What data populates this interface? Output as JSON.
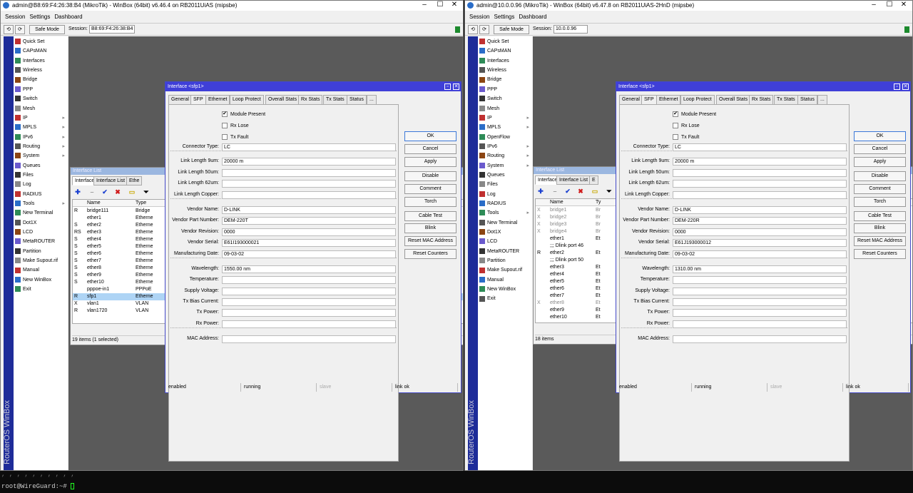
{
  "terminal": {
    "line1": "  , , , ,  , , ,   , ,  ,",
    "prompt": "root@WireGuard:~#"
  },
  "windows": [
    {
      "title": "admin@B8:69:F4:26:38:B4 (MikroTik) - WinBox (64bit) v6.46.4 on RB2011UiAS (mipsbe)",
      "menu": [
        "Session",
        "Settings",
        "Dashboard"
      ],
      "safe_mode": "Safe Mode",
      "session_label": "Session:",
      "session_value": "B8:69:F4:26:38:B4",
      "sidebar_text": "RouterOS WinBox",
      "nav": [
        {
          "label": "Quick Set",
          "icon": "quick-set-icon",
          "arrow": false
        },
        {
          "label": "CAPsMAN",
          "icon": "capsman-icon",
          "arrow": false
        },
        {
          "label": "Interfaces",
          "icon": "interfaces-icon",
          "arrow": false
        },
        {
          "label": "Wireless",
          "icon": "wireless-icon",
          "arrow": false
        },
        {
          "label": "Bridge",
          "icon": "bridge-icon",
          "arrow": false
        },
        {
          "label": "PPP",
          "icon": "ppp-icon",
          "arrow": false
        },
        {
          "label": "Switch",
          "icon": "switch-icon",
          "arrow": false
        },
        {
          "label": "Mesh",
          "icon": "mesh-icon",
          "arrow": false
        },
        {
          "label": "IP",
          "icon": "ip-icon",
          "arrow": true
        },
        {
          "label": "MPLS",
          "icon": "mpls-icon",
          "arrow": true
        },
        {
          "label": "IPv6",
          "icon": "ipv6-icon",
          "arrow": true
        },
        {
          "label": "Routing",
          "icon": "routing-icon",
          "arrow": true
        },
        {
          "label": "System",
          "icon": "system-icon",
          "arrow": true
        },
        {
          "label": "Queues",
          "icon": "queues-icon",
          "arrow": false
        },
        {
          "label": "Files",
          "icon": "files-icon",
          "arrow": false
        },
        {
          "label": "Log",
          "icon": "log-icon",
          "arrow": false
        },
        {
          "label": "RADIUS",
          "icon": "radius-icon",
          "arrow": false
        },
        {
          "label": "Tools",
          "icon": "tools-icon",
          "arrow": true
        },
        {
          "label": "New Terminal",
          "icon": "terminal-icon",
          "arrow": false
        },
        {
          "label": "Dot1X",
          "icon": "dot1x-icon",
          "arrow": false
        },
        {
          "label": "LCD",
          "icon": "lcd-icon",
          "arrow": false
        },
        {
          "label": "MetaROUTER",
          "icon": "metarouter-icon",
          "arrow": false
        },
        {
          "label": "Partition",
          "icon": "partition-icon",
          "arrow": false
        },
        {
          "label": "Make Supout.rif",
          "icon": "supout-icon",
          "arrow": false
        },
        {
          "label": "Manual",
          "icon": "manual-icon",
          "arrow": false
        },
        {
          "label": "New WinBox",
          "icon": "winbox-icon",
          "arrow": false
        },
        {
          "label": "Exit",
          "icon": "exit-icon",
          "arrow": false
        }
      ],
      "list": {
        "title": "Interface List",
        "tabs": [
          "Interface",
          "Interface List",
          "Ethe"
        ],
        "col_name": "Name",
        "col_type": "Type",
        "rows": [
          {
            "flag": "R",
            "name": "bridge111",
            "type": "Bridge"
          },
          {
            "flag": "",
            "name": "ether1",
            "type": "Etherne"
          },
          {
            "flag": "S",
            "name": "ether2",
            "type": "Etherne"
          },
          {
            "flag": "RS",
            "name": "ether3",
            "type": "Etherne"
          },
          {
            "flag": "S",
            "name": "ether4",
            "type": "Etherne"
          },
          {
            "flag": "S",
            "name": "ether5",
            "type": "Etherne"
          },
          {
            "flag": "S",
            "name": "ether6",
            "type": "Etherne"
          },
          {
            "flag": "S",
            "name": "ether7",
            "type": "Etherne"
          },
          {
            "flag": "S",
            "name": "ether8",
            "type": "Etherne"
          },
          {
            "flag": "S",
            "name": "ether9",
            "type": "Etherne"
          },
          {
            "flag": "S",
            "name": "ether10",
            "type": "Etherne"
          },
          {
            "flag": "",
            "name": "pppoe-in1",
            "type": "PPPoE"
          },
          {
            "flag": "R",
            "name": "sfp1",
            "type": "Etherne"
          },
          {
            "flag": "X",
            "name": "vlan1",
            "type": "VLAN"
          },
          {
            "flag": "R",
            "name": "vlan1720",
            "type": "VLAN"
          }
        ],
        "footer": "19 items (1 selected)"
      },
      "dialog": {
        "title": "Interface <sfp1>",
        "tabs": [
          "General",
          "SFP",
          "Ethernet",
          "Loop Protect",
          "Overall Stats",
          "Rx Stats",
          "Tx Stats",
          "Status",
          "..."
        ],
        "checks": [
          {
            "label": "Module Present",
            "checked": true
          },
          {
            "label": "Rx Lose",
            "checked": false
          },
          {
            "label": "Tx Fault",
            "checked": false
          }
        ],
        "fields": [
          {
            "label": "Connector Type:",
            "value": "LC"
          },
          {
            "label": "Link Length 9um:",
            "value": "20000 m"
          },
          {
            "label": "Link Length 50um:",
            "value": ""
          },
          {
            "label": "Link Length 62um:",
            "value": ""
          },
          {
            "label": "Link Length Copper:",
            "value": ""
          },
          {
            "label": "Vendor Name:",
            "value": "D-LINK"
          },
          {
            "label": "Vendor Part Number:",
            "value": "DEM-220T"
          },
          {
            "label": "Vendor Revision:",
            "value": "0000"
          },
          {
            "label": "Vendor Serial:",
            "value": "E61I193000021"
          },
          {
            "label": "Manufacturing Date:",
            "value": "09-03-02"
          },
          {
            "label": "Wavelength:",
            "value": "1550.00 nm"
          },
          {
            "label": "Temperature:",
            "value": ""
          },
          {
            "label": "Supply Voltage:",
            "value": ""
          },
          {
            "label": "Tx Bias Current:",
            "value": ""
          },
          {
            "label": "Tx Power:",
            "value": ""
          },
          {
            "label": "Rx Power:",
            "value": ""
          },
          {
            "label": "MAC Address:",
            "value": ""
          }
        ],
        "buttons": [
          "OK",
          "Cancel",
          "Apply",
          "Disable",
          "Comment",
          "Torch",
          "Cable Test",
          "Blink",
          "Reset MAC Address",
          "Reset Counters"
        ],
        "status": [
          "enabled",
          "running",
          "slave",
          "link ok"
        ]
      }
    },
    {
      "title": "admin@10.0.0.96 (MikroTik) - WinBox (64bit) v6.47.8 on RB2011UiAS-2HnD (mipsbe)",
      "menu": [
        "Session",
        "Settings",
        "Dashboard"
      ],
      "safe_mode": "Safe Mode",
      "session_label": "Session:",
      "session_value": "10.0.0.96",
      "sidebar_text": "RouterOS WinBox",
      "nav": [
        {
          "label": "Quick Set",
          "icon": "quick-set-icon",
          "arrow": false
        },
        {
          "label": "CAPsMAN",
          "icon": "capsman-icon",
          "arrow": false
        },
        {
          "label": "Interfaces",
          "icon": "interfaces-icon",
          "arrow": false
        },
        {
          "label": "Wireless",
          "icon": "wireless-icon",
          "arrow": false
        },
        {
          "label": "Bridge",
          "icon": "bridge-icon",
          "arrow": false
        },
        {
          "label": "PPP",
          "icon": "ppp-icon",
          "arrow": false
        },
        {
          "label": "Switch",
          "icon": "switch-icon",
          "arrow": false
        },
        {
          "label": "Mesh",
          "icon": "mesh-icon",
          "arrow": false
        },
        {
          "label": "IP",
          "icon": "ip-icon",
          "arrow": true
        },
        {
          "label": "MPLS",
          "icon": "mpls-icon",
          "arrow": true
        },
        {
          "label": "OpenFlow",
          "icon": "openflow-icon",
          "arrow": false
        },
        {
          "label": "IPv6",
          "icon": "ipv6-icon",
          "arrow": true
        },
        {
          "label": "Routing",
          "icon": "routing-icon",
          "arrow": true
        },
        {
          "label": "System",
          "icon": "system-icon",
          "arrow": true
        },
        {
          "label": "Queues",
          "icon": "queues-icon",
          "arrow": false
        },
        {
          "label": "Files",
          "icon": "files-icon",
          "arrow": false
        },
        {
          "label": "Log",
          "icon": "log-icon",
          "arrow": false
        },
        {
          "label": "RADIUS",
          "icon": "radius-icon",
          "arrow": false
        },
        {
          "label": "Tools",
          "icon": "tools-icon",
          "arrow": true
        },
        {
          "label": "New Terminal",
          "icon": "terminal-icon",
          "arrow": false
        },
        {
          "label": "Dot1X",
          "icon": "dot1x-icon",
          "arrow": false
        },
        {
          "label": "LCD",
          "icon": "lcd-icon",
          "arrow": false
        },
        {
          "label": "MetaROUTER",
          "icon": "metarouter-icon",
          "arrow": false
        },
        {
          "label": "Partition",
          "icon": "partition-icon",
          "arrow": false
        },
        {
          "label": "Make Supout.rif",
          "icon": "supout-icon",
          "arrow": false
        },
        {
          "label": "Manual",
          "icon": "manual-icon",
          "arrow": false
        },
        {
          "label": "New WinBox",
          "icon": "winbox-icon",
          "arrow": false
        },
        {
          "label": "Exit",
          "icon": "exit-icon",
          "arrow": false
        }
      ],
      "list": {
        "title": "Interface List",
        "tabs": [
          "Interface",
          "Interface List",
          "E"
        ],
        "col_name": "Name",
        "col_type": "Ty",
        "rows": [
          {
            "flag": "X",
            "name": "bridge1",
            "type": "Br",
            "dis": true
          },
          {
            "flag": "X",
            "name": "bridge2",
            "type": "Br",
            "dis": true
          },
          {
            "flag": "X",
            "name": "bridge3",
            "type": "Br",
            "dis": true
          },
          {
            "flag": "X",
            "name": "bridge4",
            "type": "Br",
            "dis": true
          },
          {
            "flag": "",
            "name": "ether1",
            "type": "Et"
          },
          {
            "flag": "",
            "name": ";;; Dlink port 46",
            "type": ""
          },
          {
            "flag": "R",
            "name": "ether2",
            "type": "Et"
          },
          {
            "flag": "",
            "name": ";;; Dlink port 50",
            "type": ""
          },
          {
            "flag": "",
            "name": "ether3",
            "type": "Et"
          },
          {
            "flag": "",
            "name": "ether4",
            "type": "Et"
          },
          {
            "flag": "",
            "name": "ether5",
            "type": "Et"
          },
          {
            "flag": "",
            "name": "ether6",
            "type": "Et"
          },
          {
            "flag": "",
            "name": "ether7",
            "type": "Et"
          },
          {
            "flag": "X",
            "name": "ether8",
            "type": "Et",
            "dis": true
          },
          {
            "flag": "",
            "name": "ether9",
            "type": "Et"
          },
          {
            "flag": "",
            "name": "ether10",
            "type": "Et"
          }
        ],
        "footer": "18 items"
      },
      "dialog": {
        "title": "Interface <sfp1>",
        "tabs": [
          "General",
          "SFP",
          "Ethernet",
          "Loop Protect",
          "Overall Stats",
          "Rx Stats",
          "Tx Stats",
          "Status",
          "..."
        ],
        "checks": [
          {
            "label": "Module Present",
            "checked": true
          },
          {
            "label": "Rx Lose",
            "checked": false
          },
          {
            "label": "Tx Fault",
            "checked": false
          }
        ],
        "fields": [
          {
            "label": "Connector Type:",
            "value": "LC"
          },
          {
            "label": "Link Length 9um:",
            "value": "20000 m"
          },
          {
            "label": "Link Length 50um:",
            "value": ""
          },
          {
            "label": "Link Length 62um:",
            "value": ""
          },
          {
            "label": "Link Length Copper:",
            "value": ""
          },
          {
            "label": "Vendor Name:",
            "value": "D-LINK"
          },
          {
            "label": "Vendor Part Number:",
            "value": "DEM-220R"
          },
          {
            "label": "Vendor Revision:",
            "value": "0000"
          },
          {
            "label": "Vendor Serial:",
            "value": "E61J193000012"
          },
          {
            "label": "Manufacturing Date:",
            "value": "09-03-02"
          },
          {
            "label": "Wavelength:",
            "value": "1310.00 nm"
          },
          {
            "label": "Temperature:",
            "value": ""
          },
          {
            "label": "Supply Voltage:",
            "value": ""
          },
          {
            "label": "Tx Bias Current:",
            "value": ""
          },
          {
            "label": "Tx Power:",
            "value": ""
          },
          {
            "label": "Rx Power:",
            "value": ""
          },
          {
            "label": "MAC Address:",
            "value": ""
          }
        ],
        "buttons": [
          "OK",
          "Cancel",
          "Apply",
          "Disable",
          "Comment",
          "Torch",
          "Cable Test",
          "Blink",
          "Reset MAC Address",
          "Reset Counters"
        ],
        "status": [
          "enabled",
          "running",
          "slave",
          "link ok"
        ]
      }
    }
  ]
}
